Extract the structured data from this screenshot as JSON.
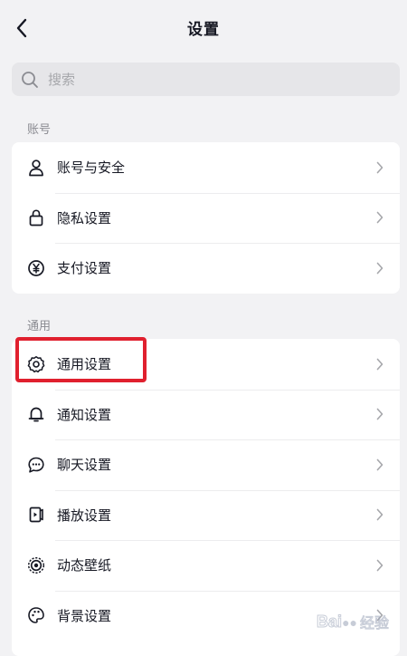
{
  "header": {
    "title": "设置"
  },
  "search": {
    "placeholder": "搜索"
  },
  "sections": [
    {
      "label": "账号",
      "items": [
        {
          "label": "账号与安全",
          "icon": "user-icon"
        },
        {
          "label": "隐私设置",
          "icon": "lock-icon"
        },
        {
          "label": "支付设置",
          "icon": "yen-icon"
        }
      ]
    },
    {
      "label": "通用",
      "items": [
        {
          "label": "通用设置",
          "icon": "gear-icon"
        },
        {
          "label": "通知设置",
          "icon": "bell-icon"
        },
        {
          "label": "聊天设置",
          "icon": "chat-bubble-icon"
        },
        {
          "label": "播放设置",
          "icon": "play-settings-icon"
        },
        {
          "label": "动态壁纸",
          "icon": "live-wallpaper-icon"
        },
        {
          "label": "背景设置",
          "icon": "palette-icon"
        }
      ]
    }
  ],
  "highlight": {
    "target": "通用设置",
    "color": "#e0202e"
  },
  "watermark": {
    "logo": "Bai",
    "logo_tail": "",
    "sub": "经验"
  },
  "colors": {
    "background": "#f2f2f4",
    "card": "#ffffff",
    "text": "#161823",
    "secondary_text": "#8a8b91"
  }
}
